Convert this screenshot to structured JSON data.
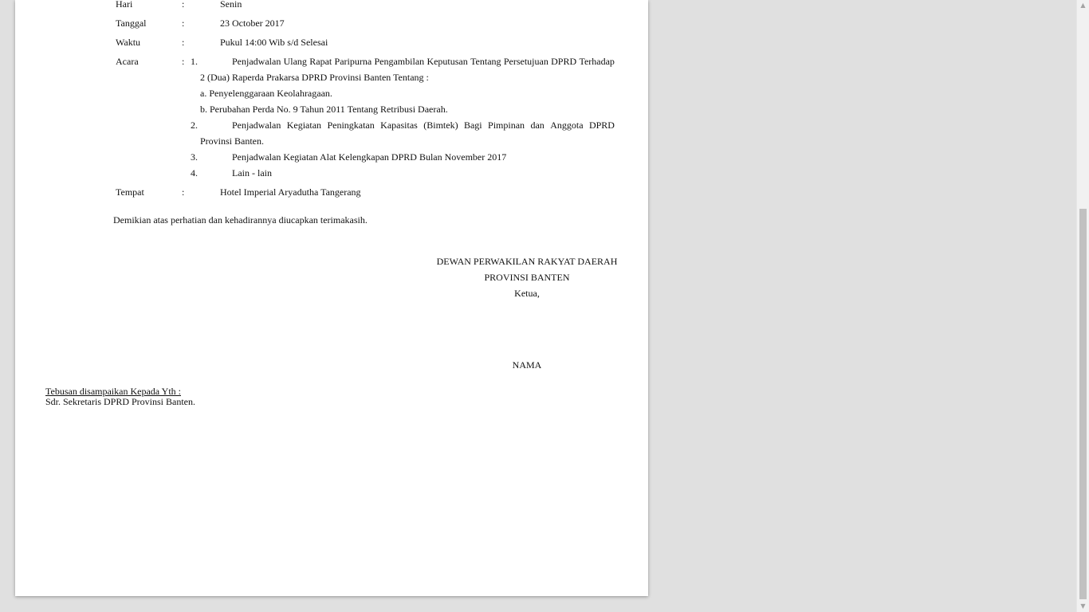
{
  "fields": {
    "hari": {
      "label": "Hari",
      "colon": ":",
      "value": "Senin"
    },
    "tanggal": {
      "label": "Tanggal",
      "colon": ":",
      "value": "23 October 2017"
    },
    "waktu": {
      "label": "Waktu",
      "colon": ":",
      "value": "Pukul 14:00 Wib s/d Selesai"
    },
    "acara": {
      "label": "Acara",
      "colon": ":"
    },
    "tempat": {
      "label": "Tempat",
      "colon": ":",
      "value": "Hotel Imperial Aryadutha Tangerang"
    }
  },
  "agenda": {
    "item1": {
      "num": "1.",
      "line1_words": [
        "Penjadwalan",
        "Ulang",
        "Rapat",
        "Paripurna",
        "Pengambilan",
        "Keputusan",
        "Tentang",
        "Persetujuan",
        "DPRD",
        "Terhadap"
      ],
      "line2": "2 (Dua) Raperda Prakarsa DPRD Provinsi Banten Tentang :",
      "sub_a": "a. Penyelenggaraan Keolahragaan.",
      "sub_b": "b. Perubahan Perda No. 9 Tahun 2011 Tentang Retribusi Daerah."
    },
    "item2": {
      "num": "2.",
      "line1_words": [
        "Penjadwalan",
        "Kegiatan",
        "Peningkatan",
        "Kapasitas",
        "(Bimtek)",
        "Bagi",
        "Pimpinan",
        "dan",
        "Anggota",
        "DPRD"
      ],
      "line2": "Provinsi Banten."
    },
    "item3": {
      "num": "3.",
      "text": "Penjadwalan Kegiatan Alat Kelengkapan DPRD Bulan November 2017"
    },
    "item4": {
      "num": "4.",
      "text": "Lain - lain"
    }
  },
  "closing": "Demikian atas perhatian dan kehadirannya diucapkan terimakasih.",
  "signature": {
    "org_line1": "DEWAN PERWAKILAN RAKYAT DAERAH",
    "org_line2": "PROVINSI BANTEN",
    "position": "Ketua,",
    "name": "NAMA"
  },
  "cc": {
    "heading": "Tebusan disampaikan Kepada Yth :",
    "recipient": "Sdr. Sekretaris DPRD Provinsi Banten."
  },
  "scrollbar": {
    "up_icon": "▲",
    "down_icon": "▼"
  }
}
